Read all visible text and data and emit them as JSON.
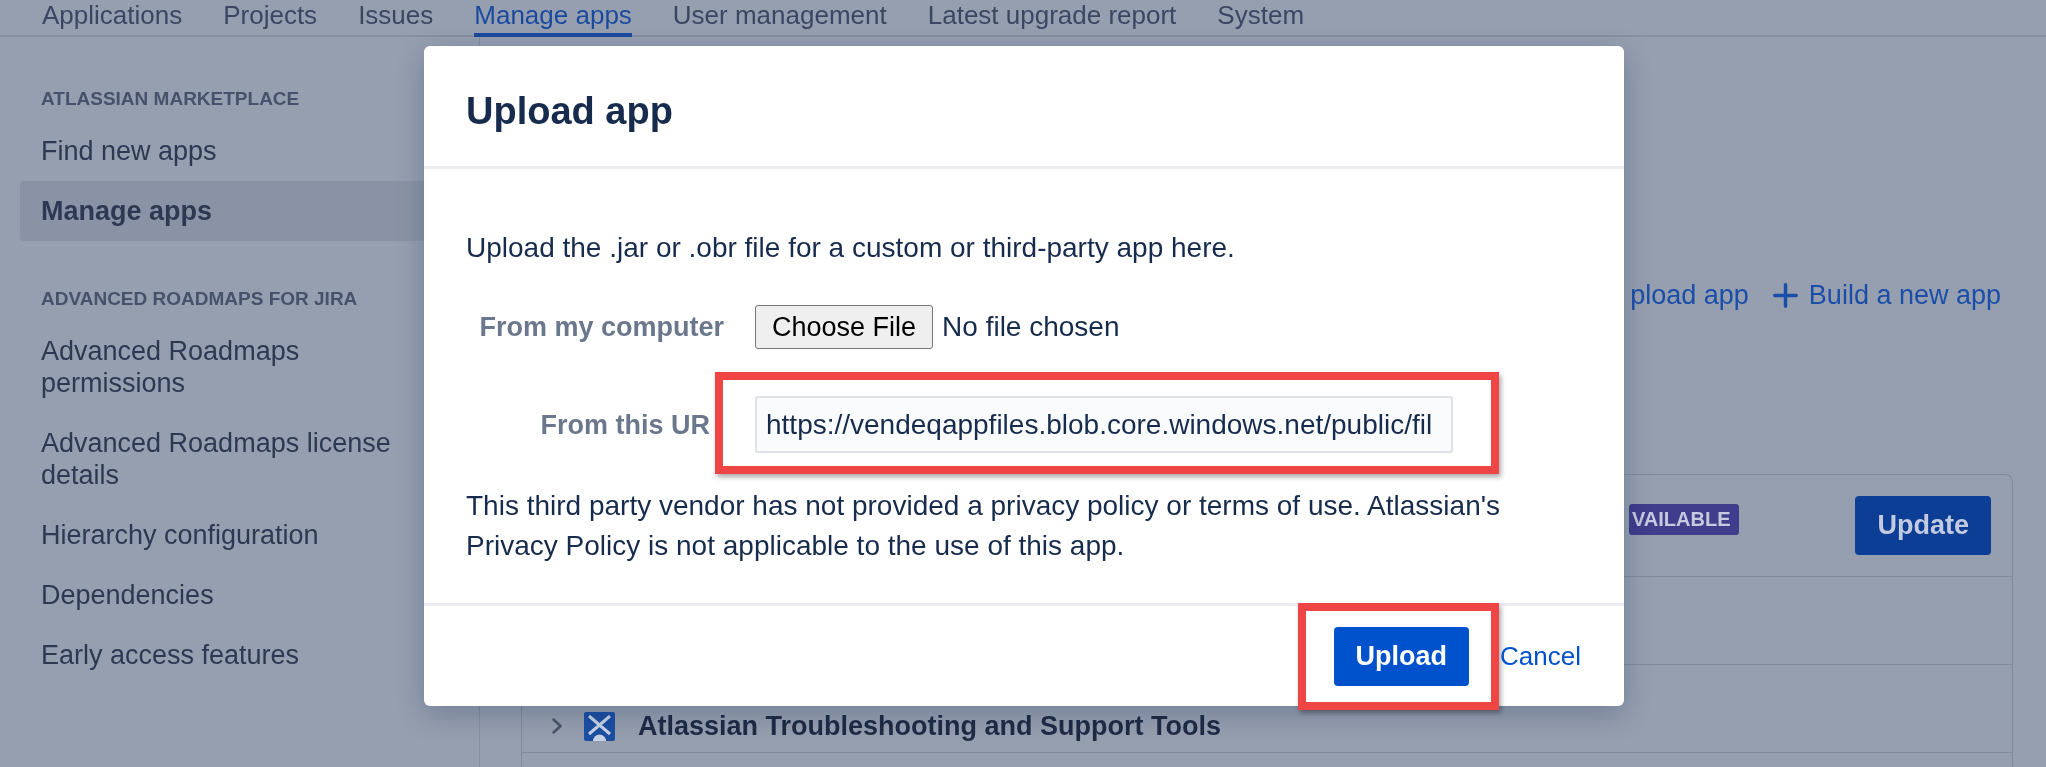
{
  "top_nav": {
    "tabs": [
      {
        "label": "Applications",
        "selected": false
      },
      {
        "label": "Projects",
        "selected": false
      },
      {
        "label": "Issues",
        "selected": false
      },
      {
        "label": "Manage apps",
        "selected": true
      },
      {
        "label": "User management",
        "selected": false
      },
      {
        "label": "Latest upgrade report",
        "selected": false
      },
      {
        "label": "System",
        "selected": false
      }
    ]
  },
  "sidebar": {
    "sections": [
      {
        "heading": "ATLASSIAN MARKETPLACE",
        "items": [
          {
            "label": "Find new apps",
            "selected": false
          },
          {
            "label": "Manage apps",
            "selected": true
          }
        ]
      },
      {
        "heading": "ADVANCED ROADMAPS FOR JIRA",
        "items": [
          {
            "label": "Advanced Roadmaps permissions",
            "selected": false
          },
          {
            "label": "Advanced Roadmaps license details",
            "selected": false
          },
          {
            "label": "Hierarchy configuration",
            "selected": false
          },
          {
            "label": "Dependencies",
            "selected": false
          },
          {
            "label": "Early access features",
            "selected": false
          }
        ]
      }
    ]
  },
  "main": {
    "actions": [
      {
        "label": "pload app",
        "kind": "plain"
      },
      {
        "label": "Build a new app",
        "kind": "add"
      }
    ],
    "app_list": {
      "header": {
        "badge": "VAILABLE",
        "button": "Update"
      },
      "rows": [
        {
          "name": "Atlassian Troubleshooting and Support Tools",
          "expanded": false
        }
      ]
    }
  },
  "dialog": {
    "title": "Upload app",
    "intro": "Upload the .jar or .obr file for a custom or third-party app here.",
    "fields": [
      {
        "kind": "file",
        "label": "From my computer",
        "button": "Choose File",
        "status": "No file chosen",
        "highlighted": false
      },
      {
        "kind": "url",
        "label": "From this UR",
        "value": "https://vendeqappfiles.blob.core.windows.net/public/fil",
        "highlighted": true
      }
    ],
    "notice": "This third party vendor has not provided a privacy policy or terms of use. Atlassian's Privacy Policy is not applicable to the use of this app.",
    "buttons": [
      {
        "kind": "primary",
        "label": "Upload",
        "highlighted": true
      },
      {
        "kind": "link",
        "label": "Cancel",
        "highlighted": false
      }
    ]
  }
}
